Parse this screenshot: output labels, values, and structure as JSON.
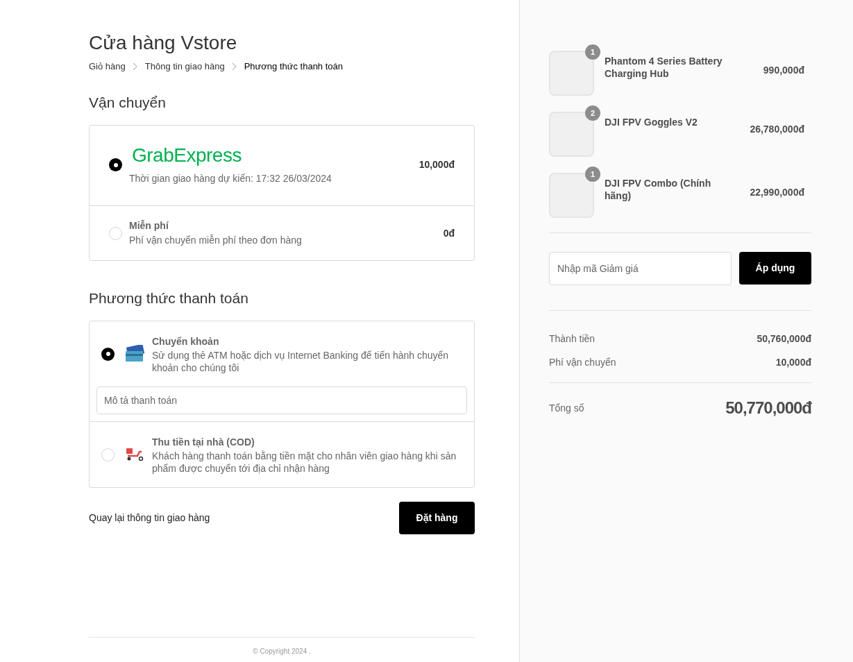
{
  "store_title": "Cửa hàng Vstore",
  "breadcrumb": [
    {
      "label": "Giỏ hàng",
      "selected": false
    },
    {
      "label": "Thông tin giao hàng",
      "selected": false
    },
    {
      "label": "Phương thức thanh toán",
      "selected": true
    }
  ],
  "shipping": {
    "heading": "Vận chuyển",
    "options": [
      {
        "kind": "logo",
        "logo": "GrabExpress",
        "description": "Thời gian giao hàng dự kiến: 17:32 26/03/2024",
        "price": "10,000đ",
        "selected": true
      },
      {
        "kind": "text",
        "title": "Miễn phí",
        "description": "Phí vận chuyển miễn phí theo đơn hàng",
        "price": "0đ",
        "selected": false
      }
    ]
  },
  "payment": {
    "heading": "Phương thức thanh toán",
    "options": [
      {
        "kind": "card",
        "title": "Chuyển khoản",
        "description": "Sử dụng thẻ ATM hoặc dịch vụ Internet Banking để tiến hành chuyển khoản cho chúng tôi",
        "field": {
          "placeholder": "Mô tả thanh toán"
        },
        "selected": true
      },
      {
        "kind": "scooter",
        "title": "Thu tiền tại nhà (COD)",
        "description": "Khách hàng thanh toán bằng tiền mặt cho nhân viên giao hàng khi sản phẩm được chuyển tới địa chỉ nhận hàng",
        "selected": false
      }
    ]
  },
  "back_link": "Quay lại thông tin giao hàng",
  "order_button": "Đặt hàng",
  "footer": "© Copyright 2024 .",
  "cart": {
    "items": [
      {
        "name": "Phantom 4 Series Battery Charging Hub",
        "quantity": "1",
        "price": "990,000đ"
      },
      {
        "name": "DJI FPV Goggles V2",
        "quantity": "2",
        "price": "26,780,000đ"
      },
      {
        "name": "DJI FPV Combo (Chính hãng)",
        "quantity": "1",
        "price": "22,990,000đ"
      }
    ],
    "discount": {
      "placeholder": "Nhập mã Giảm giá",
      "button": "Áp dụng"
    },
    "lines": [
      {
        "label": "Thành tiền",
        "value": "50,760,000đ"
      },
      {
        "label": "Phí vận chuyển",
        "value": "10,000đ"
      }
    ],
    "total": {
      "label": "Tổng số",
      "value": "50,770,000đ"
    }
  }
}
